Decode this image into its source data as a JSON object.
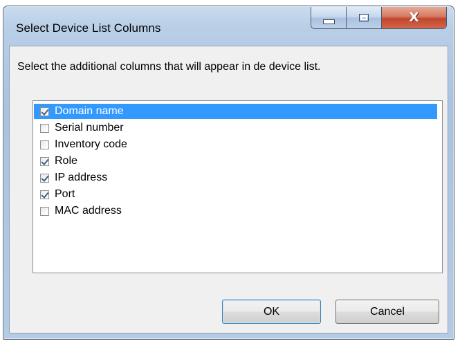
{
  "window": {
    "title": "Select Device List Columns"
  },
  "caption_buttons": {
    "minimize_icon": "minimize-icon",
    "maximize_icon": "maximize-icon",
    "close_icon": "close-icon",
    "close_glyph": "X"
  },
  "instruction": "Select the additional columns that will appear in de device list.",
  "columns": [
    {
      "label": "Domain name",
      "checked": true,
      "selected": true
    },
    {
      "label": "Serial number",
      "checked": false,
      "selected": false
    },
    {
      "label": "Inventory code",
      "checked": false,
      "selected": false
    },
    {
      "label": "Role",
      "checked": true,
      "selected": false
    },
    {
      "label": "IP address",
      "checked": true,
      "selected": false
    },
    {
      "label": "Port",
      "checked": true,
      "selected": false
    },
    {
      "label": "MAC address",
      "checked": false,
      "selected": false
    }
  ],
  "buttons": {
    "ok_label": "OK",
    "cancel_label": "Cancel"
  },
  "colors": {
    "selection": "#3399ff",
    "close_button": "#c2452c",
    "title_bar": "#b9cfe6",
    "client_background": "#f0f0f0"
  }
}
